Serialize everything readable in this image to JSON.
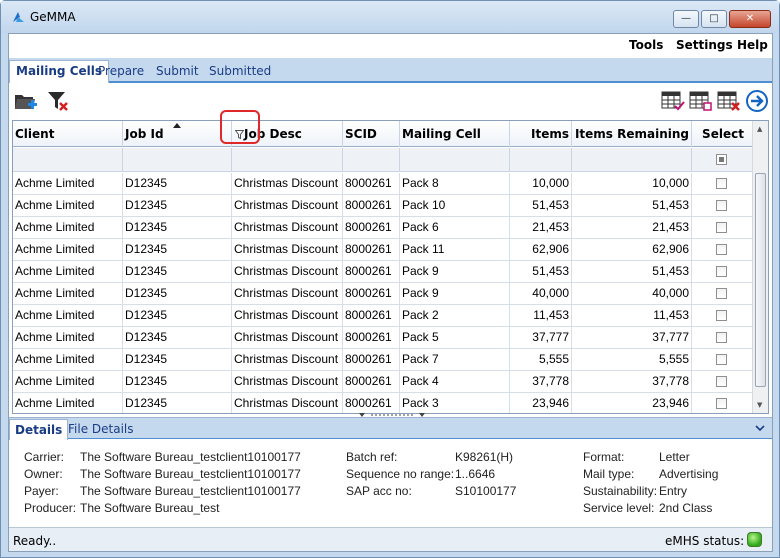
{
  "window": {
    "title": "GeMMA",
    "min_glyph": "—",
    "max_glyph": "□",
    "close_glyph": "✕"
  },
  "menu": [
    "Tools",
    "Settings",
    "Help"
  ],
  "tabs": [
    "Mailing Cells",
    "Prepare",
    "Submit",
    "Submitted"
  ],
  "grid": {
    "columns": [
      "Client",
      "Job Id",
      "Job Desc",
      "SCID",
      "Mailing Cell",
      "Items",
      "Items Remaining",
      "Select"
    ],
    "rows": [
      [
        "Achme Limited",
        "D12345",
        "Christmas Discount",
        "8000261",
        "Pack 8",
        "10,000",
        "10,000"
      ],
      [
        "Achme Limited",
        "D12345",
        "Christmas Discount",
        "8000261",
        "Pack 10",
        "51,453",
        "51,453"
      ],
      [
        "Achme Limited",
        "D12345",
        "Christmas Discount",
        "8000261",
        "Pack 6",
        "21,453",
        "21,453"
      ],
      [
        "Achme Limited",
        "D12345",
        "Christmas Discount",
        "8000261",
        "Pack 11",
        "62,906",
        "62,906"
      ],
      [
        "Achme Limited",
        "D12345",
        "Christmas Discount",
        "8000261",
        "Pack 9",
        "51,453",
        "51,453"
      ],
      [
        "Achme Limited",
        "D12345",
        "Christmas Discount",
        "8000261",
        "Pack 9",
        "40,000",
        "40,000"
      ],
      [
        "Achme Limited",
        "D12345",
        "Christmas Discount",
        "8000261",
        "Pack 2",
        "11,453",
        "11,453"
      ],
      [
        "Achme Limited",
        "D12345",
        "Christmas Discount",
        "8000261",
        "Pack 5",
        "37,777",
        "37,777"
      ],
      [
        "Achme Limited",
        "D12345",
        "Christmas Discount",
        "8000261",
        "Pack 7",
        "5,555",
        "5,555"
      ],
      [
        "Achme Limited",
        "D12345",
        "Christmas Discount",
        "8000261",
        "Pack 4",
        "37,778",
        "37,778"
      ],
      [
        "Achme Limited",
        "D12345",
        "Christmas Discount",
        "8000261",
        "Pack 3",
        "23,946",
        "23,946"
      ]
    ]
  },
  "details_tabs": [
    "Details",
    "File Details"
  ],
  "details": {
    "left": [
      {
        "label": "Carrier:",
        "value": "The Software Bureau_testclient10100177"
      },
      {
        "label": "Owner:",
        "value": "The Software Bureau_testclient10100177"
      },
      {
        "label": "Payer:",
        "value": "The Software Bureau_testclient10100177"
      },
      {
        "label": "Producer:",
        "value": "The Software Bureau_test"
      }
    ],
    "middle": [
      {
        "label": "Batch ref:",
        "value": "K98261(H)"
      },
      {
        "label": "Sequence no range:",
        "value": "1..6646"
      },
      {
        "label": "SAP acc no:",
        "value": "S10100177"
      }
    ],
    "right": [
      {
        "label": "Format:",
        "value": "Letter"
      },
      {
        "label": "Mail type:",
        "value": "Advertising"
      },
      {
        "label": "Sustainability:",
        "value": "Entry"
      },
      {
        "label": "Service level:",
        "value": "2nd Class"
      }
    ]
  },
  "status": {
    "text": "Ready..",
    "emhs_label": "eMHS status:",
    "emhs_color": "#2fa81a"
  },
  "colors": {
    "accent": "#4f8ed1",
    "highlight": "#e0272a"
  }
}
